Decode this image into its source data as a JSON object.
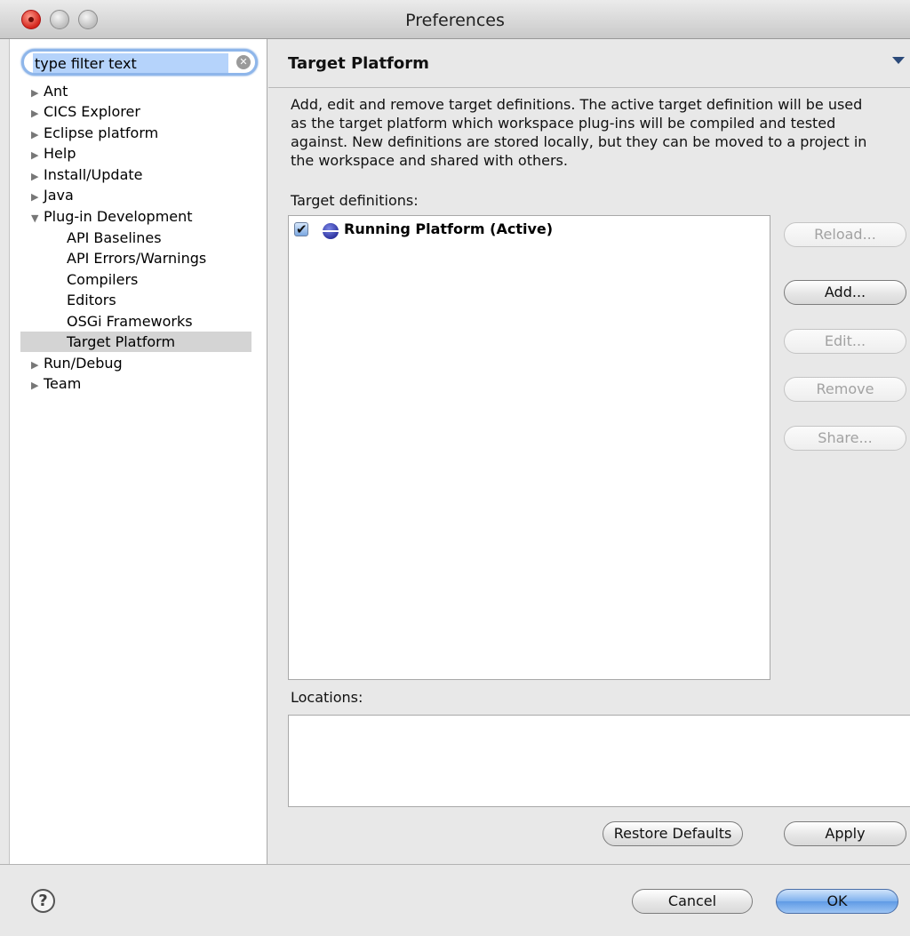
{
  "window": {
    "title": "Preferences"
  },
  "filter": {
    "value": "type filter text"
  },
  "tree": {
    "items": [
      {
        "label": "Ant",
        "expander": "collapsed"
      },
      {
        "label": "CICS Explorer",
        "expander": "collapsed"
      },
      {
        "label": "Eclipse platform",
        "expander": "collapsed"
      },
      {
        "label": "Help",
        "expander": "collapsed"
      },
      {
        "label": "Install/Update",
        "expander": "collapsed"
      },
      {
        "label": "Java",
        "expander": "collapsed"
      },
      {
        "label": "Plug-in Development",
        "expander": "expanded"
      },
      {
        "label": "API Baselines",
        "expander": "none"
      },
      {
        "label": "API Errors/Warnings",
        "expander": "none"
      },
      {
        "label": "Compilers",
        "expander": "none"
      },
      {
        "label": "Editors",
        "expander": "none"
      },
      {
        "label": "OSGi Frameworks",
        "expander": "none"
      },
      {
        "label": "Target Platform",
        "expander": "none",
        "selected": true
      },
      {
        "label": "Run/Debug",
        "expander": "collapsed"
      },
      {
        "label": "Team",
        "expander": "collapsed"
      }
    ]
  },
  "page": {
    "title": "Target Platform",
    "description_lines": [
      "Add, edit and remove target definitions.  The active target definition will be used",
      "as the target platform which workspace plug-ins will be compiled and tested",
      "against.  New definitions are stored locally, but they can be moved to a project in",
      "the workspace and shared with others."
    ],
    "target_definitions_label": "Target definitions:",
    "target_definitions": [
      {
        "label": "Running Platform (Active)",
        "checked": true,
        "icon": "platform-globe-icon"
      }
    ],
    "locations_label": "Locations:",
    "side_buttons": {
      "reload": "Reload...",
      "add": "Add...",
      "edit": "Edit...",
      "remove": "Remove",
      "share": "Share..."
    },
    "restore_defaults": "Restore Defaults",
    "apply": "Apply"
  },
  "footer": {
    "help_glyph": "?",
    "cancel": "Cancel",
    "ok": "OK"
  },
  "icons": {
    "expander_collapsed": "▶",
    "expander_expanded": "▼",
    "clear": "✕"
  }
}
